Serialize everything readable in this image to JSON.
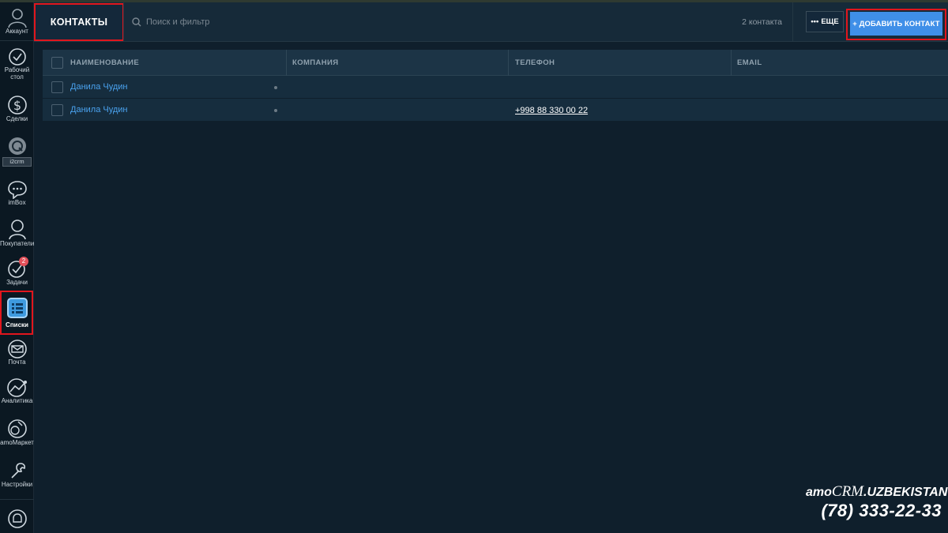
{
  "sidebar": {
    "items": [
      {
        "label": "Аккаунт",
        "icon": "account-icon"
      },
      {
        "label": "Рабочий стол",
        "icon": "dashboard-icon"
      },
      {
        "label": "Сделки",
        "icon": "deals-icon"
      },
      {
        "label": "i2crm",
        "icon": "i2crm-icon"
      },
      {
        "label": "imBox",
        "icon": "chat-icon"
      },
      {
        "label": "Покупатели",
        "icon": "customers-icon"
      },
      {
        "label": "Задачи",
        "icon": "tasks-icon",
        "badge": "2"
      },
      {
        "label": "Списки",
        "icon": "lists-icon",
        "active": true
      },
      {
        "label": "Почта",
        "icon": "mail-icon"
      },
      {
        "label": "Аналитика",
        "icon": "analytics-icon"
      },
      {
        "label": "amoМаркет",
        "icon": "market-icon"
      },
      {
        "label": "Настройки",
        "icon": "settings-icon"
      },
      {
        "label": "",
        "icon": "notifications-icon"
      }
    ]
  },
  "header": {
    "title": "КОНТАКТЫ",
    "search_placeholder": "Поиск и фильтр",
    "count": "2 контакта",
    "more_label": "ЕЩЕ",
    "add_label": "+ ДОБАВИТЬ КОНТАКТ"
  },
  "table": {
    "columns": [
      "НАИМЕНОВАНИЕ",
      "КОМПАНИЯ",
      "ТЕЛЕФОН",
      "EMAIL"
    ],
    "rows": [
      {
        "name": "Данила Чудин",
        "company": "",
        "phone": "",
        "email": ""
      },
      {
        "name": "Данила Чудин",
        "company": "",
        "phone": "+998 88 330 00 22",
        "email": ""
      }
    ]
  },
  "watermark": {
    "brand_prefix": "amo",
    "brand_main": "CRM",
    "brand_suffix": ".UZBEKISTAN",
    "phone": "(78) 333-22-33"
  },
  "colors": {
    "background": "#0f1f2c",
    "accent": "#3f8fe8",
    "link": "#4aa3f0",
    "highlight": "#e1161d",
    "badge": "#e3515a"
  }
}
